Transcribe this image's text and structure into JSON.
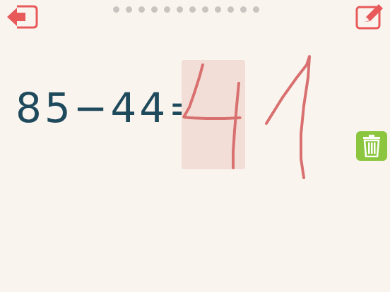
{
  "toolbar": {
    "back_icon": "back-arrow-exit-icon",
    "edit_icon": "pencil-edit-icon",
    "accent_color": "#e85a5a"
  },
  "progress": {
    "total_pages": 12,
    "current_page": 1
  },
  "equation": {
    "text": "85−44=",
    "entered_answer": "4",
    "text_color": "#1e4a5c",
    "answer_color": "#e52a2a"
  },
  "handwriting": {
    "stroke_color": "#d97070",
    "digits_drawn": 2
  },
  "trash": {
    "icon": "trash-icon",
    "color": "#8cc63f"
  }
}
